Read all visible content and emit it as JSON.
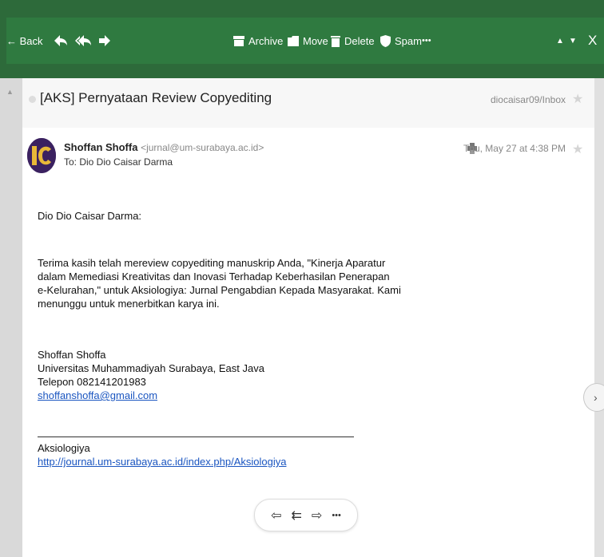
{
  "toolbar": {
    "back_label": "← Back",
    "archive_label": "Archive",
    "move_label": "Move",
    "delete_label": "Delete",
    "spam_label": "Spam",
    "more_label": "•••",
    "prev_label": "▲",
    "next_label": "▼",
    "close_label": "X"
  },
  "message": {
    "subject": "[AKS] Pernyataan Review Copyediting",
    "folder": "diocaisar09/Inbox",
    "sender_name": "Shoffan Shoffa",
    "sender_email": "<jurnal@um-surabaya.ac.id>",
    "to_line": "To: Dio Dio Caisar Darma",
    "date": "Thu, May 27 at 4:38 PM",
    "greeting": "Dio Dio Caisar Darma:",
    "paragraph_lines": [
      "Terima kasih telah mereview copyediting manuskrip Anda, \"Kinerja Aparatur",
      "dalam Memediasi Kreativitas dan Inovasi Terhadap Keberhasilan Penerapan",
      "e-Kelurahan,\" untuk Aksiologiya: Jurnal Pengabdian Kepada Masyarakat. Kami",
      "menunggu untuk menerbitkan karya ini."
    ],
    "signature": {
      "name": "Shoffan Shoffa",
      "affiliation": "Universitas Muhammadiyah Surabaya, East Java",
      "phone": "Telepon 082141201983",
      "email_link": "shoffanshoffa@gmail.com"
    },
    "footer": {
      "journal": "Aksiologiya",
      "link": "http://journal.um-surabaya.ac.id/index.php/Aksiologiya"
    }
  },
  "reply_bar": {
    "reply": "⇦",
    "reply_all": "⇇",
    "forward": "⇨",
    "more": "•••"
  },
  "colors": {
    "toolbar_bg": "#2f7a40",
    "link": "#1a55c0"
  }
}
